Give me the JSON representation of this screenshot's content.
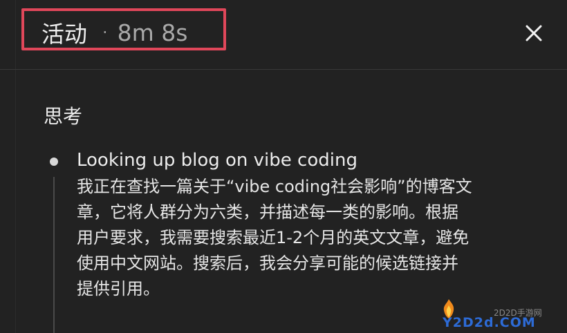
{
  "header": {
    "title": "活动",
    "separator": "·",
    "elapsed": "8m 8s",
    "close_icon": "close-icon"
  },
  "section": {
    "heading": "思考"
  },
  "steps": [
    {
      "title": "Looking up blog on vibe coding",
      "body_lines": [
        "我正在查找一篇关于“vibe coding社会影响”的博客文",
        "章，它将人群分为六类，并描述每一类的影响。根据",
        "用户要求，我需要搜索最近1-2个月的英文文章，避免",
        "使用中文网站。搜索后，我会分享可能的候选链接并",
        "提供引用。"
      ]
    }
  ],
  "watermark": {
    "site": "2D2D手游网",
    "logo": "Y2D2d.COM"
  },
  "colors": {
    "background": "#222222",
    "highlight_border": "#e0475a",
    "text": "#ececec",
    "muted": "#a9a9a9"
  }
}
